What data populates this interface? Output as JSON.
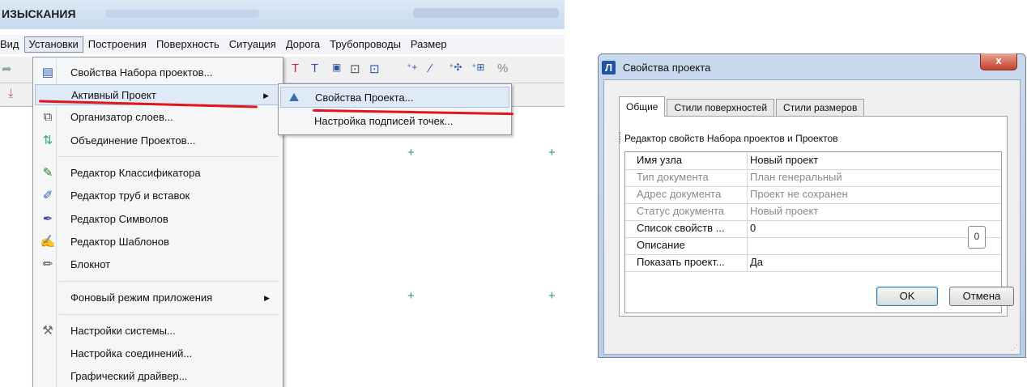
{
  "app": {
    "title": "ИЗЫСКАНИЯ",
    "menubar": [
      "Вид",
      "Установки",
      "Построения",
      "Поверхность",
      "Ситуация",
      "Дорога",
      "Трубопроводы",
      "Размер"
    ],
    "active_menu_index": 1
  },
  "menu": {
    "items": [
      {
        "label": "Свойства Набора проектов...",
        "icon": "folder-properties-icon"
      },
      {
        "label": "Активный Проект",
        "icon": "",
        "submenu": true,
        "highlighted": true
      },
      {
        "label": "Организатор слоев...",
        "icon": "layers-icon"
      },
      {
        "label": "Объединение Проектов...",
        "icon": "merge-projects-icon"
      },
      {
        "label": "Редактор Классификатора",
        "icon": "classifier-editor-icon"
      },
      {
        "label": "Редактор труб и вставок",
        "icon": "pipe-editor-icon"
      },
      {
        "label": "Редактор Символов",
        "icon": "symbol-editor-icon"
      },
      {
        "label": "Редактор Шаблонов",
        "icon": "template-editor-icon"
      },
      {
        "label": "Блокнот",
        "icon": "notepad-icon"
      },
      {
        "label": "Фоновый режим приложения",
        "icon": "",
        "submenu": true
      },
      {
        "label": "Настройки системы...",
        "icon": "tools-icon"
      },
      {
        "label": "Настройка соединений...",
        "icon": ""
      },
      {
        "label": "Графический драйвер...",
        "icon": ""
      }
    ]
  },
  "submenu": {
    "items": [
      {
        "label": "Свойства Проекта...",
        "icon": "project-properties-icon",
        "highlighted": true
      },
      {
        "label": "Настройка подписей точек...",
        "icon": ""
      }
    ]
  },
  "dialog": {
    "icon_letter": "Л",
    "title": "Свойства проекта",
    "close_label": "x",
    "tabs": [
      "Общие",
      "Стили поверхностей",
      "Стили размеров"
    ],
    "active_tab": 0,
    "section_header": "Редактор свойств Набора проектов и Проектов",
    "properties": [
      {
        "key": "Имя узла",
        "value": "Новый проект",
        "enabled": true
      },
      {
        "key": "Тип документа",
        "value": "План генеральный",
        "enabled": false
      },
      {
        "key": "Адрес документа",
        "value": "Проект не сохранен",
        "enabled": false
      },
      {
        "key": "Статус документа",
        "value": "Новый проект",
        "enabled": false
      },
      {
        "key": "Список свойств ...",
        "value": "0",
        "enabled": true
      },
      {
        "key": "Описание",
        "value": "",
        "enabled": true
      },
      {
        "key": "Показать проект...",
        "value": "Да",
        "enabled": true
      }
    ],
    "badge": "0",
    "ok_label": "OK",
    "cancel_label": "Отмена"
  },
  "colors": {
    "annotation_underline": "#e0161a",
    "menu_highlight": "#dfeaf8",
    "title_bar": "#c9dbef"
  }
}
